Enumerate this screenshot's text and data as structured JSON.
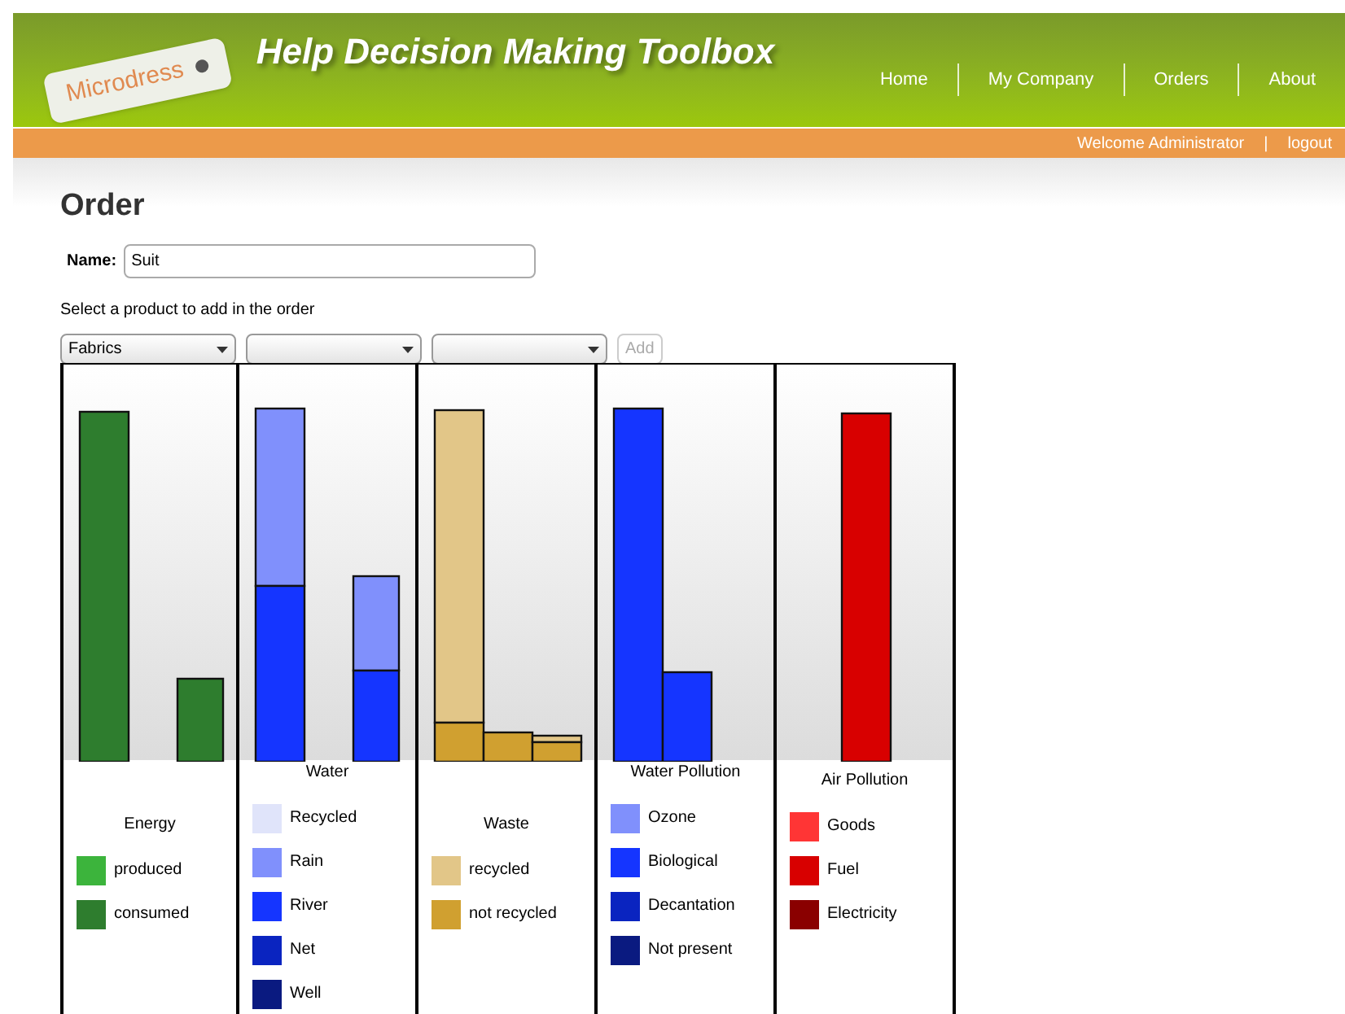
{
  "header": {
    "logo": "Microdress",
    "title": "Help Decision Making Toolbox",
    "nav": [
      "Home",
      "My Company",
      "Orders",
      "About"
    ]
  },
  "user_bar": {
    "welcome": "Welcome Administrator",
    "separator": "|",
    "logout": "logout"
  },
  "page": {
    "heading": "Order",
    "name_label": "Name:",
    "name_value": "Suit",
    "hint": "Select a product to add in the order",
    "dropdowns": [
      {
        "kind": "dropdown",
        "value": "Fabrics"
      },
      {
        "kind": "dropdown"
      },
      {
        "kind": "dropdown"
      }
    ],
    "add_button": {
      "label": "Add",
      "disabled": true
    }
  },
  "panels": [
    {
      "title": "Energy",
      "legend": [
        {
          "label": "produced",
          "color": "#3cb43c"
        },
        {
          "label": "consumed",
          "color": "#2e7d2e"
        }
      ]
    },
    {
      "title": "Water",
      "legend": [
        {
          "label": "Recycled",
          "color": "#e0e4fa"
        },
        {
          "label": "Rain",
          "color": "#8090fc"
        },
        {
          "label": "River",
          "color": "#1535ff"
        },
        {
          "label": "Net",
          "color": "#0a24c0"
        },
        {
          "label": "Well",
          "color": "#0a1a80"
        }
      ]
    },
    {
      "title": "Waste",
      "legend": [
        {
          "label": "recycled",
          "color": "#e2c688"
        },
        {
          "label": "not recycled",
          "color": "#d0a030"
        }
      ]
    },
    {
      "title": "Water Pollution",
      "legend": [
        {
          "label": "Ozone",
          "color": "#8090fc"
        },
        {
          "label": "Biological",
          "color": "#1535ff"
        },
        {
          "label": "Decantation",
          "color": "#0a24c0"
        },
        {
          "label": "Not present",
          "color": "#0a1a80"
        }
      ]
    },
    {
      "title": "Air Pollution",
      "legend": [
        {
          "label": "Goods",
          "color": "#ff3535"
        },
        {
          "label": "Fuel",
          "color": "#d80000"
        },
        {
          "label": "Electricity",
          "color": "#8a0000"
        }
      ]
    }
  ]
}
